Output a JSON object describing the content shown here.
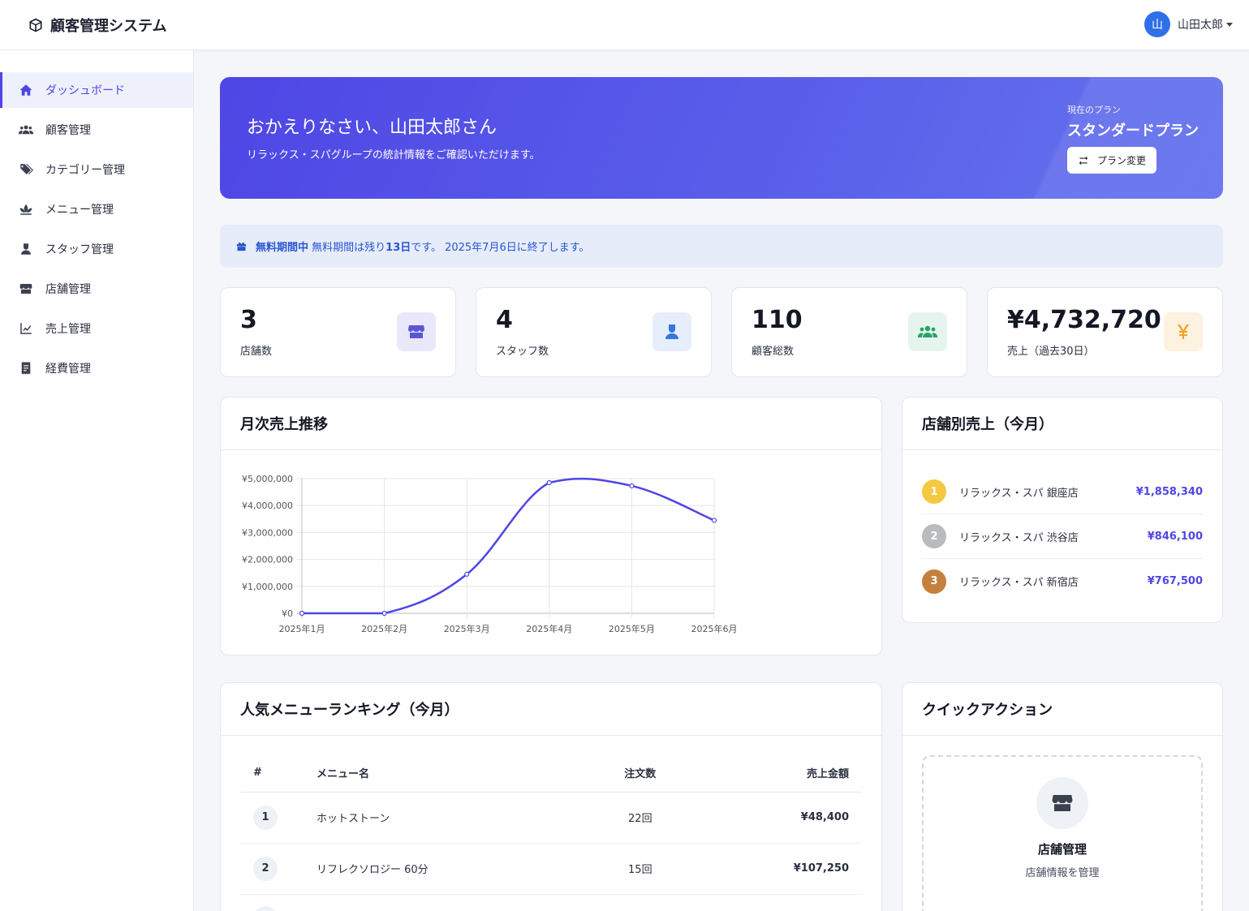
{
  "app": {
    "title": "顧客管理システム"
  },
  "user": {
    "avatar_initial": "山",
    "name": "山田太郎"
  },
  "sidebar": {
    "items": [
      {
        "label": "ダッシュボード",
        "icon": "home-icon"
      },
      {
        "label": "顧客管理",
        "icon": "users-icon"
      },
      {
        "label": "カテゴリー管理",
        "icon": "tags-icon"
      },
      {
        "label": "メニュー管理",
        "icon": "spa-icon"
      },
      {
        "label": "スタッフ管理",
        "icon": "staff-icon"
      },
      {
        "label": "店舗管理",
        "icon": "store-icon"
      },
      {
        "label": "売上管理",
        "icon": "chart-line-icon"
      },
      {
        "label": "経費管理",
        "icon": "receipt-icon"
      }
    ]
  },
  "welcome": {
    "title": "おかえりなさい、山田太郎さん",
    "subtitle": "リラックス・スパグループの統計情報をご確認いただけます。",
    "plan_label": "現在のプラン",
    "plan_name": "スタンダードプラン",
    "plan_button": "プラン変更"
  },
  "notice": {
    "strong": "無料期間中",
    "text_before": "無料期間は残り",
    "days": "13日",
    "text_after": "です。 2025年7月6日に終了します。"
  },
  "stats": [
    {
      "value": "3",
      "label": "店舗数",
      "icon": "store-icon",
      "color": "#5a57d6",
      "bg": "#e9e8fb"
    },
    {
      "value": "4",
      "label": "スタッフ数",
      "icon": "staff-icon",
      "color": "#3577e0",
      "bg": "#e6eefb"
    },
    {
      "value": "110",
      "label": "顧客総数",
      "icon": "users-icon",
      "color": "#28a36a",
      "bg": "#e5f5ed"
    },
    {
      "value": "¥4,732,720",
      "label": "売上（過去30日）",
      "icon": "yen-icon",
      "color": "#f0a32a",
      "bg": "#fdf1e0"
    }
  ],
  "monthly_chart": {
    "title": "月次売上推移",
    "chart_data": {
      "type": "line",
      "x": [
        "2025年1月",
        "2025年2月",
        "2025年3月",
        "2025年4月",
        "2025年5月",
        "2025年6月"
      ],
      "values": [
        0,
        0,
        1450000,
        4850000,
        4730000,
        3450000
      ],
      "yticks": [
        "¥0",
        "¥1,000,000",
        "¥2,000,000",
        "¥3,000,000",
        "¥4,000,000",
        "¥5,000,000"
      ],
      "ylim": [
        0,
        5000000
      ],
      "color": "#4f46e5",
      "grid": true
    }
  },
  "store_sales": {
    "title": "店舗別売上（今月）",
    "rows": [
      {
        "rank": "1",
        "name": "リラックス・スパ 銀座店",
        "amount": "¥1,858,340",
        "color": "#f5c842"
      },
      {
        "rank": "2",
        "name": "リラックス・スパ 渋谷店",
        "amount": "¥846,100",
        "color": "#b9bbbf"
      },
      {
        "rank": "3",
        "name": "リラックス・スパ 新宿店",
        "amount": "¥767,500",
        "color": "#c5803d"
      }
    ]
  },
  "menu_ranking": {
    "title": "人気メニューランキング（今月）",
    "headers": {
      "rank": "#",
      "name": "メニュー名",
      "count": "注文数",
      "amount": "売上金額"
    },
    "rows": [
      {
        "rank": "1",
        "name": "ホットストーン",
        "count": "22回",
        "amount": "¥48,400"
      },
      {
        "rank": "2",
        "name": "リフレクソロジー 60分",
        "count": "15回",
        "amount": "¥107,250"
      }
    ]
  },
  "quick_actions": {
    "title": "クイックアクション",
    "items": [
      {
        "title": "店舗管理",
        "desc": "店舗情報を管理",
        "icon": "store-icon"
      }
    ]
  }
}
